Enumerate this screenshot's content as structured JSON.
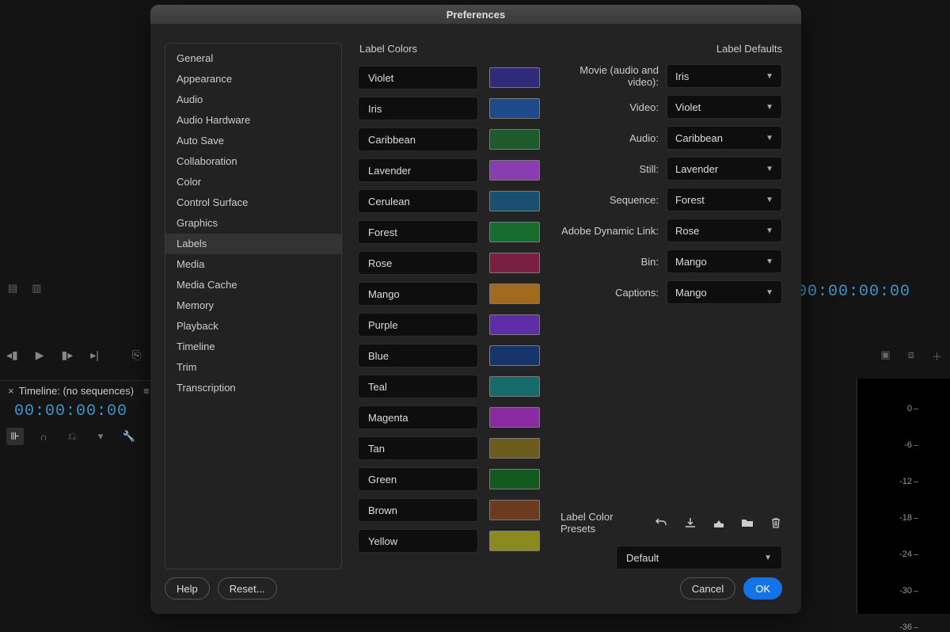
{
  "dialog": {
    "title": "Preferences",
    "sidebar": {
      "items": [
        "General",
        "Appearance",
        "Audio",
        "Audio Hardware",
        "Auto Save",
        "Collaboration",
        "Color",
        "Control Surface",
        "Graphics",
        "Labels",
        "Media",
        "Media Cache",
        "Memory",
        "Playback",
        "Timeline",
        "Trim",
        "Transcription"
      ],
      "selected": "Labels"
    },
    "label_colors_header": "Label Colors",
    "label_defaults_header": "Label Defaults",
    "colors": [
      {
        "name": "Violet",
        "hex": "#2f2a7a"
      },
      {
        "name": "Iris",
        "hex": "#1f4a8a"
      },
      {
        "name": "Caribbean",
        "hex": "#1f5a2a"
      },
      {
        "name": "Lavender",
        "hex": "#8a3db0"
      },
      {
        "name": "Cerulean",
        "hex": "#1b4f72"
      },
      {
        "name": "Forest",
        "hex": "#166b2f"
      },
      {
        "name": "Rose",
        "hex": "#7a1f3f"
      },
      {
        "name": "Mango",
        "hex": "#a06a1f"
      },
      {
        "name": "Purple",
        "hex": "#5e2da8"
      },
      {
        "name": "Blue",
        "hex": "#16366b"
      },
      {
        "name": "Teal",
        "hex": "#176a6a"
      },
      {
        "name": "Magenta",
        "hex": "#8a2aa0"
      },
      {
        "name": "Tan",
        "hex": "#6b5b1f"
      },
      {
        "name": "Green",
        "hex": "#145a1f"
      },
      {
        "name": "Brown",
        "hex": "#6b3a1f"
      },
      {
        "name": "Yellow",
        "hex": "#8a8a1f"
      }
    ],
    "defaults": [
      {
        "label": "Movie (audio and video):",
        "value": "Iris"
      },
      {
        "label": "Video:",
        "value": "Violet"
      },
      {
        "label": "Audio:",
        "value": "Caribbean"
      },
      {
        "label": "Still:",
        "value": "Lavender"
      },
      {
        "label": "Sequence:",
        "value": "Forest"
      },
      {
        "label": "Adobe Dynamic Link:",
        "value": "Rose"
      },
      {
        "label": "Bin:",
        "value": "Mango"
      },
      {
        "label": "Captions:",
        "value": "Mango"
      }
    ],
    "presets": {
      "label": "Label Color Presets",
      "value": "Default"
    },
    "footer": {
      "help": "Help",
      "reset": "Reset...",
      "cancel": "Cancel",
      "ok": "OK"
    }
  },
  "background": {
    "timecode": "00:00:00:00",
    "timeline_panel": "Timeline: (no sequences)",
    "ruler_ticks": [
      0,
      -6,
      -12,
      -18,
      -24,
      -30,
      -36
    ]
  }
}
